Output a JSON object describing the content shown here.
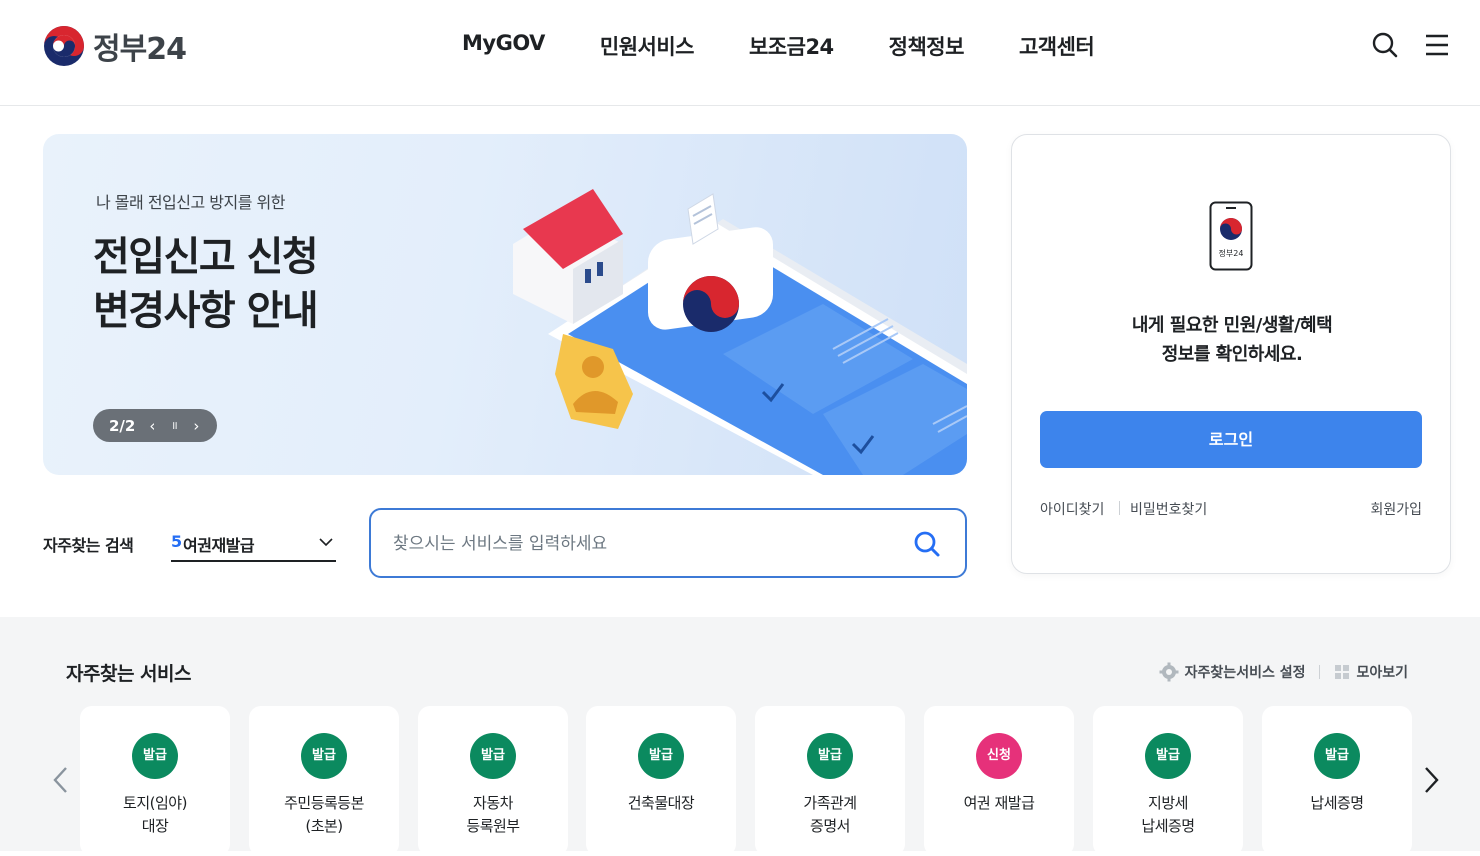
{
  "header": {
    "logo_text": "정부24",
    "nav": [
      "MyGOV",
      "민원서비스",
      "보조금24",
      "정책정보",
      "고객센터"
    ],
    "search_icon": "search-icon",
    "menu_icon": "hamburger-menu-icon"
  },
  "banner": {
    "subtitle": "나 몰래 전입신고 방지를 위한",
    "title_line1": "전입신고 신청",
    "title_line2": "변경사항 안내",
    "counter": "2/2",
    "prev": "‹",
    "pause": "॥",
    "next": "›"
  },
  "quick_search": {
    "label": "자주찾는 검색",
    "rank": "5",
    "selected": "여권재발급"
  },
  "search": {
    "placeholder": "찾으시는 서비스를 입력하세요"
  },
  "login": {
    "phone_label": "정부24",
    "message_line1": "내게 필요한 민원/생활/혜택",
    "message_line2": "정보를 확인하세요.",
    "button": "로그인",
    "find_id": "아이디찾기",
    "find_pw": "비밀번호찾기",
    "join": "회원가입"
  },
  "services": {
    "title": "자주찾는 서비스",
    "settings": "자주찾는서비스 설정",
    "view_all": "모아보기",
    "badge_colors": {
      "발급": "#0b8a5f",
      "신청": "#e6317a"
    },
    "items": [
      {
        "badge": "발급",
        "label": "토지(임야)\n대장"
      },
      {
        "badge": "발급",
        "label": "주민등록등본\n(초본)"
      },
      {
        "badge": "발급",
        "label": "자동차\n등록원부"
      },
      {
        "badge": "발급",
        "label": "건축물대장"
      },
      {
        "badge": "발급",
        "label": "가족관계\n증명서"
      },
      {
        "badge": "신청",
        "label": "여권 재발급"
      },
      {
        "badge": "발급",
        "label": "지방세\n납세증명"
      },
      {
        "badge": "발급",
        "label": "납세증명"
      }
    ]
  }
}
